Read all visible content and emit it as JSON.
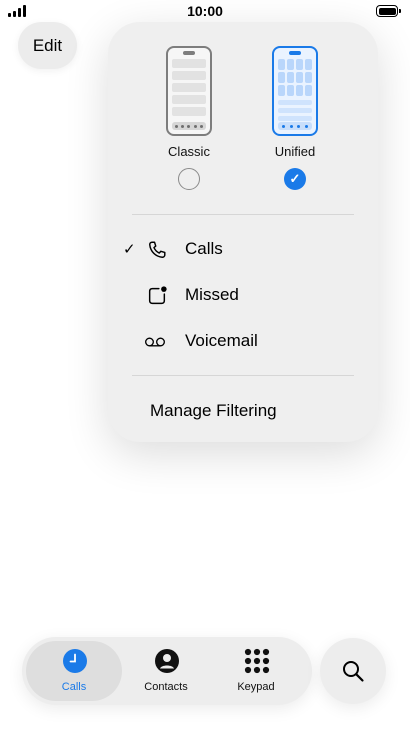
{
  "status_bar": {
    "time": "10:00"
  },
  "toolbar": {
    "edit_label": "Edit"
  },
  "layout_menu": {
    "options": [
      {
        "label": "Classic",
        "selected": false
      },
      {
        "label": "Unified",
        "selected": true
      }
    ],
    "items": [
      {
        "label": "Calls",
        "icon": "phone-icon",
        "checked": true
      },
      {
        "label": "Missed",
        "icon": "missed-icon",
        "checked": false
      },
      {
        "label": "Voicemail",
        "icon": "voicemail-icon",
        "checked": false
      }
    ],
    "manage_filtering": "Manage Filtering"
  },
  "tab_bar": {
    "tabs": [
      {
        "label": "Calls",
        "icon": "clock-icon",
        "active": true
      },
      {
        "label": "Contacts",
        "icon": "person-icon",
        "active": false
      },
      {
        "label": "Keypad",
        "icon": "keypad-icon",
        "active": false
      }
    ],
    "search_icon": "search-icon"
  },
  "colors": {
    "accent": "#1a7ae8",
    "menu_background": "#efefef",
    "pill_background": "#ececec"
  }
}
